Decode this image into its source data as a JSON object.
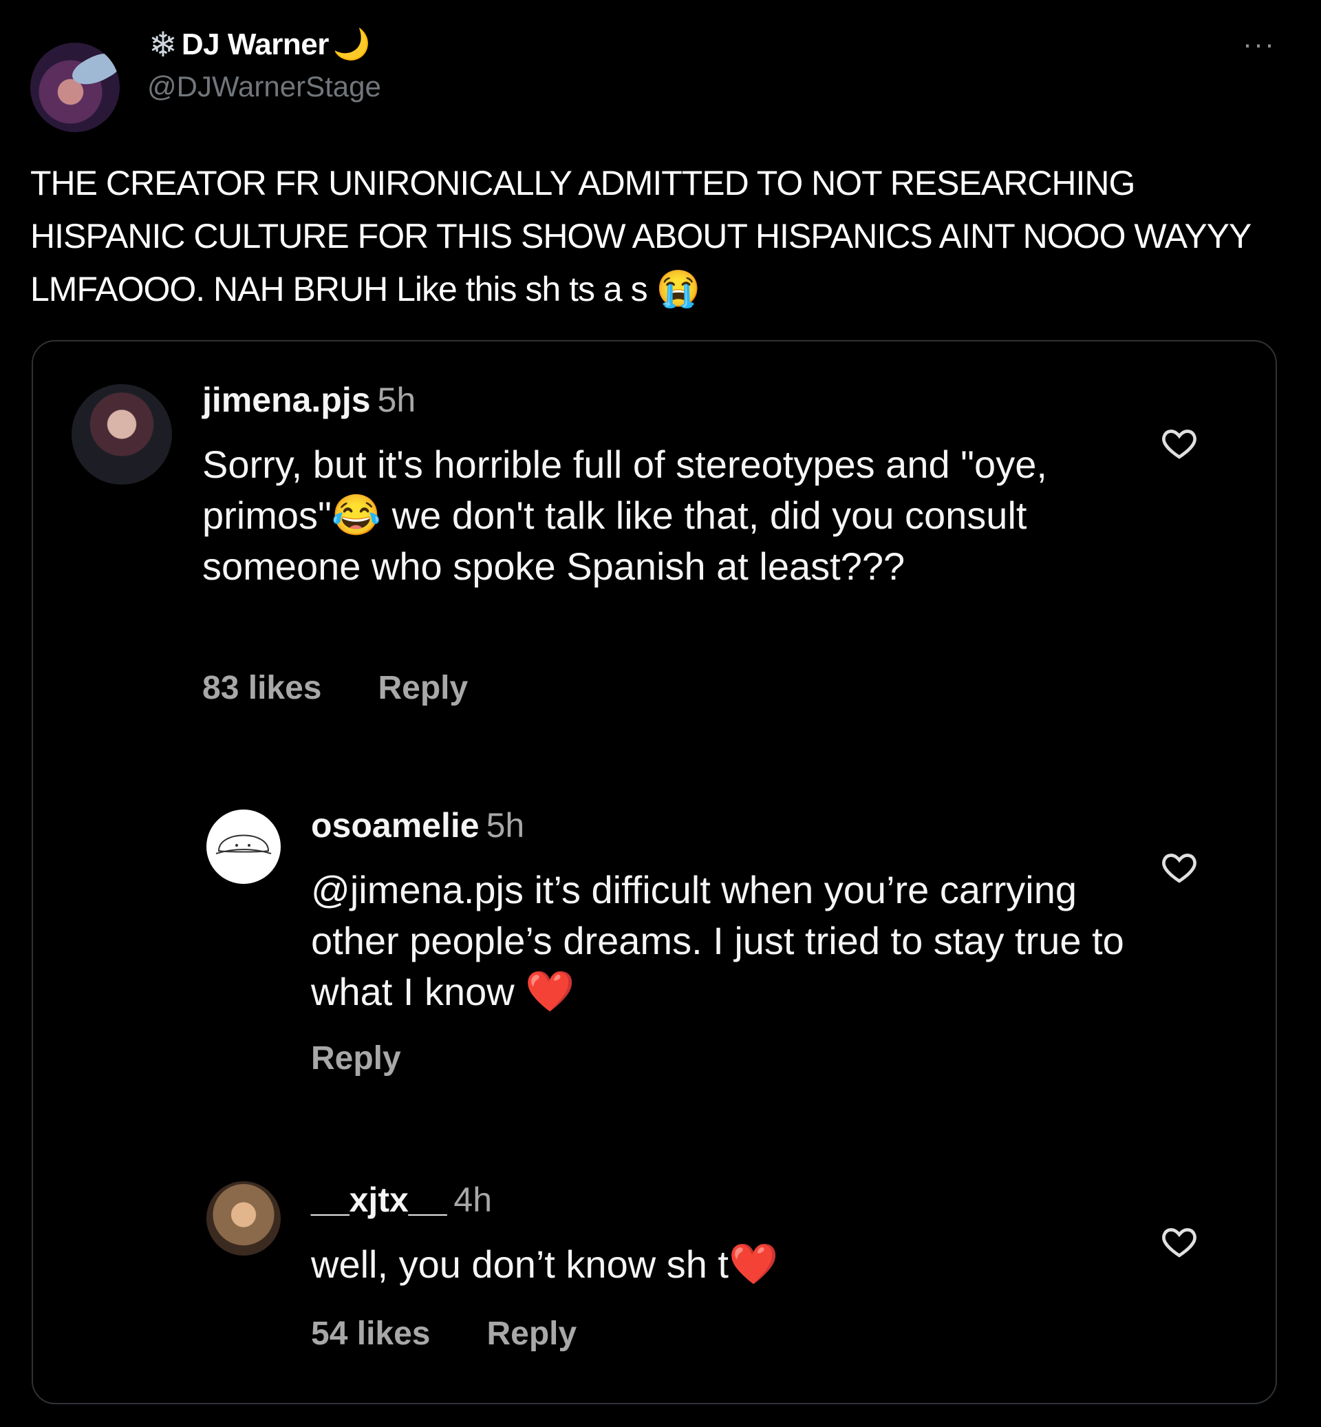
{
  "tweet": {
    "snowflake": "❄",
    "display_name": "DJ Warner",
    "moon": "🌙",
    "handle": "@DJWarnerStage",
    "more": "···",
    "text": "THE CREATOR FR UNIRONICALLY ADMITTED TO NOT RESEARCHING HISPANIC CULTURE FOR THIS SHOW ABOUT HISPANICS AINT NOOO WAYYY LMFAOOO. NAH BRUH Like this sh ts a s",
    "text_emoji": "😭"
  },
  "comments": [
    {
      "username": "jimena.pjs",
      "time": "5h",
      "body_part1": "Sorry, but it's horrible full of stereotypes and \"oye, primos\"",
      "emoji": "😂",
      "body_part2": " we don't talk like that, did you consult someone who spoke Spanish at least???",
      "likes": "83 likes",
      "reply": "Reply"
    },
    {
      "username": "osoamelie",
      "time": "5h",
      "body_part1": "@jimena.pjs it’s difficult when you’re carrying other people’s dreams. I just tried to stay true to what I know ",
      "emoji": "❤️",
      "reply": "Reply"
    },
    {
      "username": "__xjtx__",
      "time": "4h",
      "body_part1": "well, you don’t know sh t",
      "emoji": "❤️",
      "likes": "54 likes",
      "reply": "Reply"
    }
  ],
  "colors": {
    "background": "#000000",
    "text": "#ffffff",
    "muted": "#a8a8a8",
    "border": "#2f3336"
  },
  "icons": [
    "snowflake-icon",
    "moon-icon",
    "more-icon",
    "heart-icon"
  ]
}
